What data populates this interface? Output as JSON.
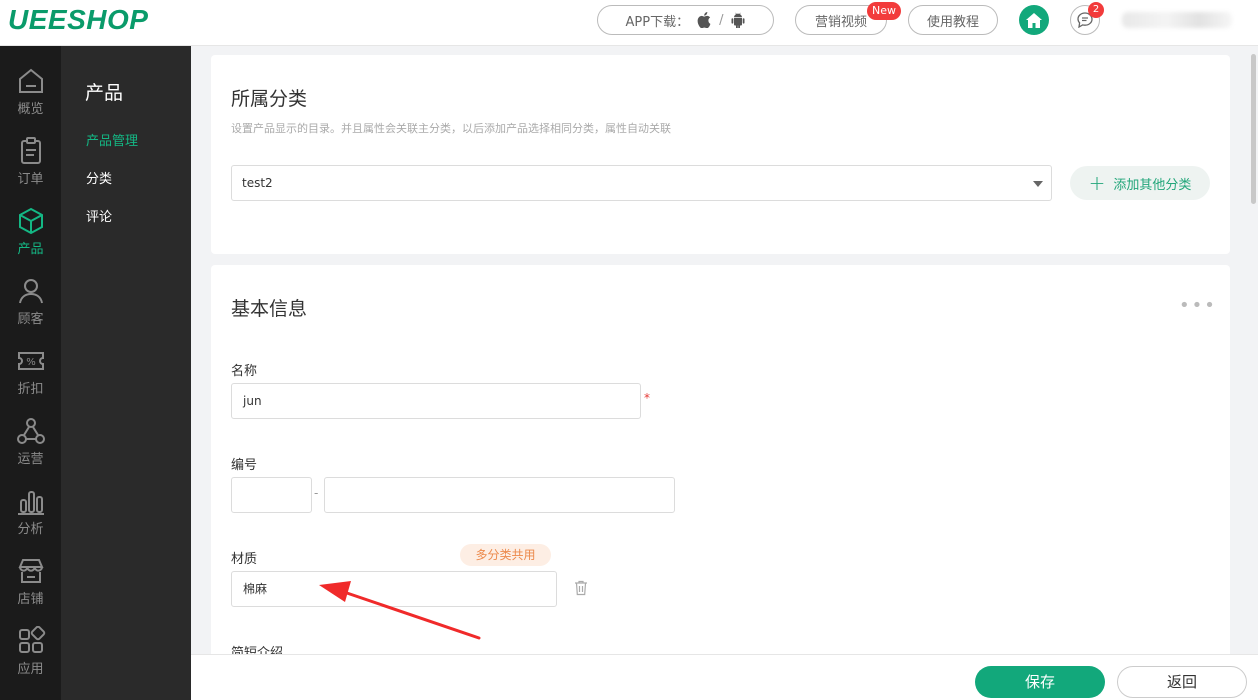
{
  "brand": {
    "logo": "UEESHOP",
    "accent": "#12a87b"
  },
  "topbar": {
    "app_download": "APP下载：",
    "app_sep": "/",
    "marketing_video": "营销视频",
    "new_badge": "New",
    "tutorial": "使用教程",
    "message_count": "2"
  },
  "leftnav": [
    {
      "label": "概览",
      "icon": "home-outline-icon",
      "active": false
    },
    {
      "label": "订单",
      "icon": "clipboard-icon",
      "active": false
    },
    {
      "label": "产品",
      "icon": "cube-icon",
      "active": true
    },
    {
      "label": "顾客",
      "icon": "user-icon",
      "active": false
    },
    {
      "label": "折扣",
      "icon": "percent-ticket-icon",
      "active": false
    },
    {
      "label": "运营",
      "icon": "share-nodes-icon",
      "active": false
    },
    {
      "label": "分析",
      "icon": "bar-chart-icon",
      "active": false
    },
    {
      "label": "店铺",
      "icon": "store-icon",
      "active": false
    },
    {
      "label": "应用",
      "icon": "apps-icon",
      "active": false
    }
  ],
  "subnav": {
    "title": "产品",
    "items": [
      {
        "label": "产品管理",
        "active": true
      },
      {
        "label": "分类",
        "active": false
      },
      {
        "label": "评论",
        "active": false
      }
    ]
  },
  "category_card": {
    "title": "所属分类",
    "description": "设置产品显示的目录。并且属性会关联主分类，以后添加产品选择相同分类，属性自动关联",
    "selected": "test2",
    "add_button": "添加其他分类"
  },
  "basic_card": {
    "title": "基本信息",
    "name_label": "名称",
    "name_value": "jun",
    "required_mark": "*",
    "code_label": "编号",
    "code_prefix": "",
    "code_sep": "-",
    "code_value": "",
    "material_label": "材质",
    "shared_tag": "多分类共用",
    "material_value": "棉麻",
    "intro_label": "简短介绍"
  },
  "footer": {
    "save": "保存",
    "back": "返回"
  }
}
